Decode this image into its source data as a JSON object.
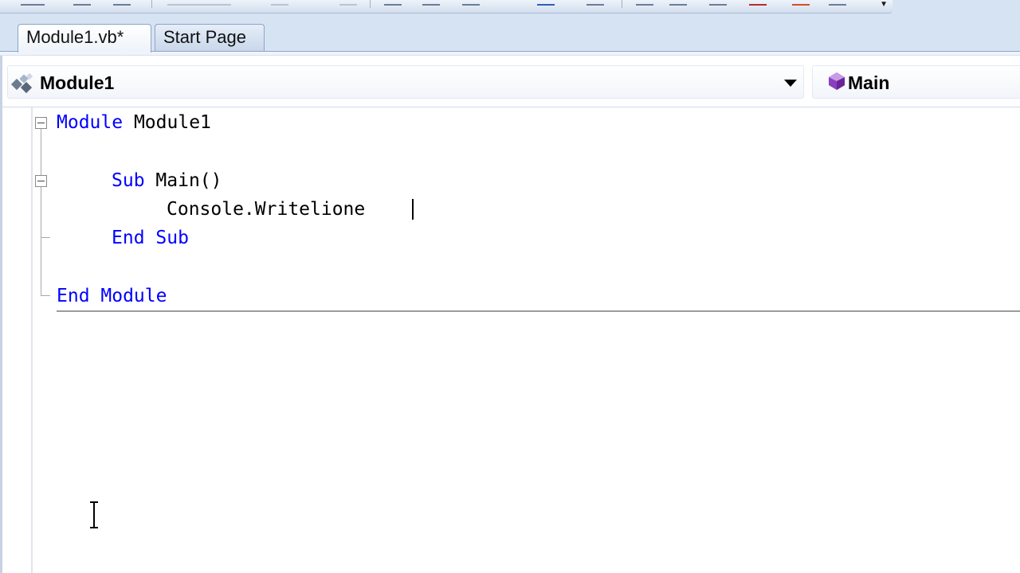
{
  "tabs": [
    {
      "label": "Module1.vb*",
      "active": true
    },
    {
      "label": "Start Page",
      "active": false
    }
  ],
  "navbar": {
    "class_selector": {
      "value": "Module1",
      "icon": "module-class-icon"
    },
    "member_selector": {
      "value": "Main",
      "icon": "method-icon"
    }
  },
  "code": {
    "line1": {
      "keyword": "Module",
      "name": "Module1"
    },
    "line3": {
      "keyword": "Sub",
      "name": "Main()"
    },
    "line4": {
      "text": "Console.Writelione"
    },
    "line5": {
      "keyword": "End Sub"
    },
    "line7": {
      "keyword": "End Module"
    }
  },
  "colors": {
    "keyword": "#0000ff",
    "text": "#000000",
    "chrome": "#d6e3f3"
  },
  "icons": [
    "tb-overflow-arrow-icon",
    "module-class-icon",
    "method-icon",
    "dropdown-arrow-icon",
    "collapse-icon",
    "ibeam-cursor-icon"
  ]
}
